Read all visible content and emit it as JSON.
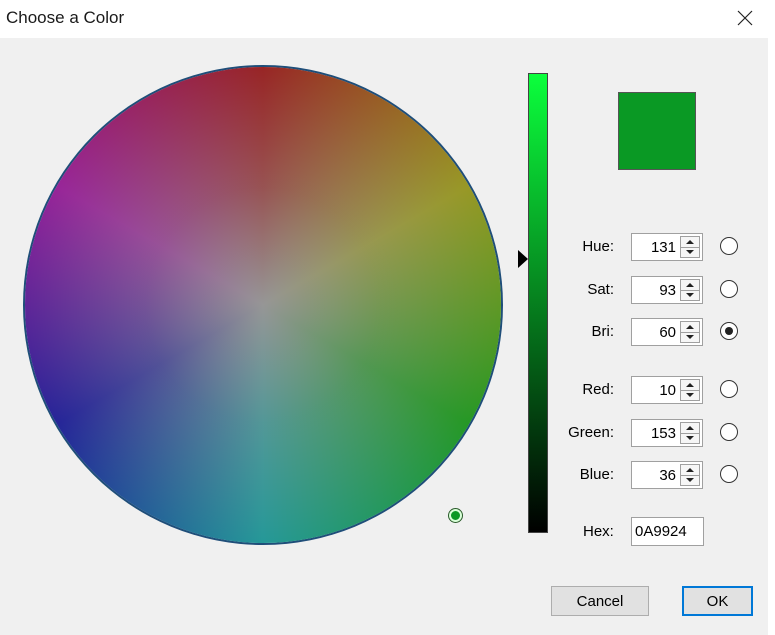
{
  "window": {
    "title": "Choose a Color",
    "close_icon": "close-icon"
  },
  "color": {
    "current_hex_color": "#0a9924",
    "slider_top_color": "#0bff3c",
    "slider_bottom_color": "#000000"
  },
  "fields": {
    "hue": {
      "label": "Hue:",
      "value": "131",
      "selected": false
    },
    "sat": {
      "label": "Sat:",
      "value": "93",
      "selected": false
    },
    "bri": {
      "label": "Bri:",
      "value": "60",
      "selected": true
    },
    "red": {
      "label": "Red:",
      "value": "10",
      "selected": false
    },
    "green": {
      "label": "Green:",
      "value": "153",
      "selected": false
    },
    "blue": {
      "label": "Blue:",
      "value": "36",
      "selected": false
    },
    "hex": {
      "label": "Hex:",
      "value": "0A9924"
    }
  },
  "buttons": {
    "cancel": "Cancel",
    "ok": "OK"
  }
}
